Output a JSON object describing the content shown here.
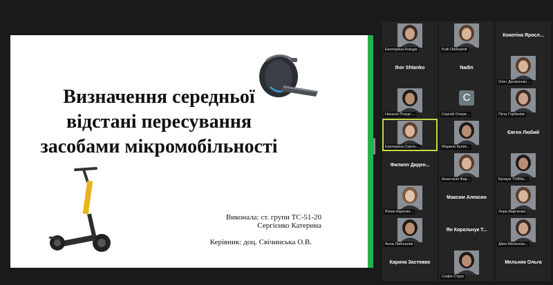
{
  "slide": {
    "title_lines": [
      "Визначення середньої",
      "відстані пересування",
      "засобами мікромобільності"
    ],
    "author_line1": "Виконала: ст. групи ТС-51-20",
    "author_line2": "Сергієнко Катерина",
    "supervisor": "Керівник: доц. Свічинська О.В."
  },
  "colors": {
    "active_speaker": "#c9d64a",
    "share_indicator": "#22b14c"
  },
  "participants": [
    {
      "name": "Екатерина Ковцур",
      "video": true
    },
    {
      "name": "Kolii Oleksandr",
      "video": true
    },
    {
      "name": "Кокотіна Ярослава",
      "display": "Кокотіна Яросл...",
      "video": false
    },
    {
      "name": "Ihor Shtanko",
      "video": false
    },
    {
      "name": "Nadin",
      "video": false
    },
    {
      "name": "Олег Денисенко",
      "display": "Олег Денисенко ...",
      "video": true
    },
    {
      "name": "Наталія Птиця",
      "display": "Наталія Птиця ...",
      "video": true
    },
    {
      "name": "Сергей Очерет",
      "display": "Сергей Очере...",
      "avatar_letter": "C",
      "video": false
    },
    {
      "name": "Пётр Горбачёв",
      "video": true
    },
    {
      "name": "Екатерина Сергієнко",
      "display": "Екатерина Сергіє...",
      "video": true,
      "active": true
    },
    {
      "name": "Марина Кулик",
      "display": "Марина Кулик...",
      "video": true
    },
    {
      "name": "Євген Любий",
      "video": false
    },
    {
      "name": "Филипп Диденко",
      "display": "Филипп Диден...",
      "video": false
    },
    {
      "name": "Анастасія Фар...",
      "video": true
    },
    {
      "name": "Бунауи ТЗ4Ма...",
      "video": true
    },
    {
      "name": "Юлия Карягин...",
      "video": true
    },
    {
      "name": "Максим Алексин",
      "video": false
    },
    {
      "name": "Лера Марченко",
      "video": true
    },
    {
      "name": "Анна Лабошник",
      "video": true
    },
    {
      "name": "Ян Корольчук",
      "display": "Ян Корольчук Т...",
      "video": false
    },
    {
      "name": "Діма Меленєвс...",
      "video": true
    },
    {
      "name": "Карина Застежко",
      "video": false
    },
    {
      "name": "Софія Струк",
      "video": true
    },
    {
      "name": "Мельник Ольга",
      "video": false
    }
  ]
}
